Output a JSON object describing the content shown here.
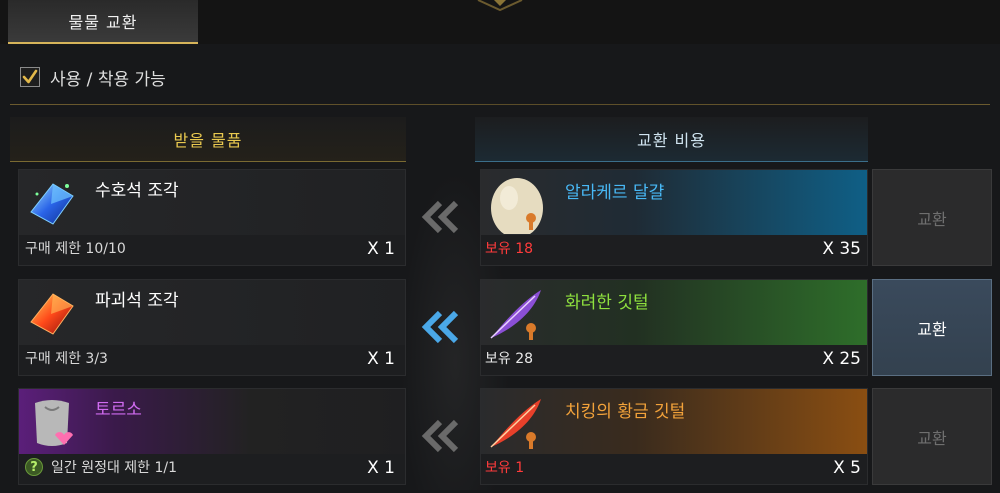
{
  "tab": {
    "label": "물물 교환"
  },
  "filter": {
    "label": "사용 / 착용 가능",
    "checked": true
  },
  "headers": {
    "receive": "받을 물품",
    "cost": "교환 비용"
  },
  "rows": [
    {
      "receive": {
        "name": "수호석 조각",
        "limit": "구매 제한 10/10",
        "qty": "X 1",
        "icon": "blue-crystal-icon"
      },
      "cost": {
        "name": "알라케르 달걀",
        "held": "보유 18",
        "qty": "X 35",
        "icon": "egg-icon"
      },
      "button": {
        "label": "교환",
        "enabled": false
      }
    },
    {
      "receive": {
        "name": "파괴석 조각",
        "limit": "구매 제한 3/3",
        "qty": "X 1",
        "icon": "red-crystal-icon"
      },
      "cost": {
        "name": "화려한 깃털",
        "held": "보유 28",
        "qty": "X 25",
        "icon": "purple-feather-icon"
      },
      "button": {
        "label": "교환",
        "enabled": true
      }
    },
    {
      "receive": {
        "name": "토르소",
        "limit": "일간 원정대 제한 1/1",
        "qty": "X 1",
        "icon": "torso-icon",
        "help_icon": "?"
      },
      "cost": {
        "name": "치킹의 황금 깃털",
        "held": "보유 1",
        "qty": "X 5",
        "icon": "red-feather-icon"
      },
      "button": {
        "label": "교환",
        "enabled": false
      }
    }
  ],
  "colors": {
    "accent_gold": "#e9c94f",
    "held_insufficient": "#ff3b3b",
    "arrow_active": "#4aa8e8",
    "arrow_inactive": "#6a6a6a"
  }
}
